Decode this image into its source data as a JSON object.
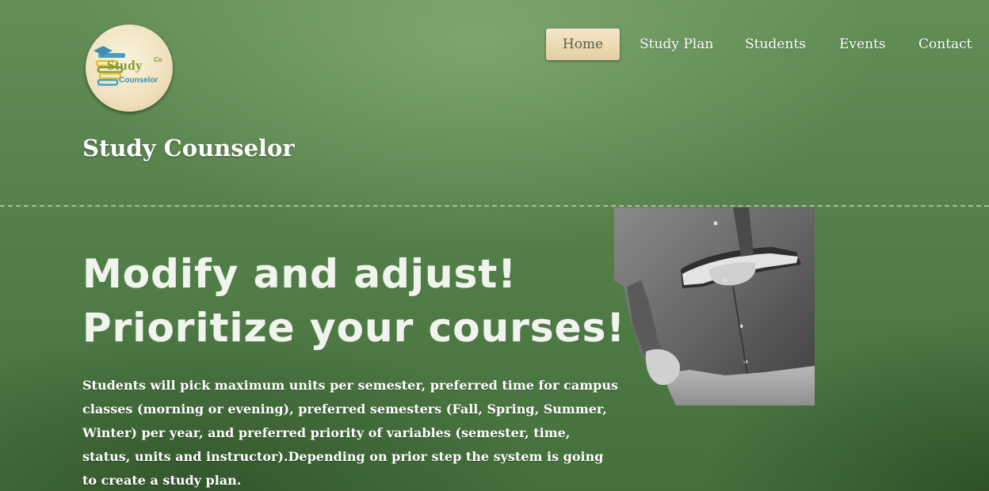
{
  "logo": {
    "study": "Study",
    "co": "Co",
    "counselor": "Counselor"
  },
  "site": {
    "name": "Study Counselor"
  },
  "nav": {
    "items": [
      {
        "label": "Home",
        "active": true
      },
      {
        "label": "Study Plan",
        "active": false
      },
      {
        "label": "Students",
        "active": false
      },
      {
        "label": "Events",
        "active": false
      },
      {
        "label": "Contact",
        "active": false
      }
    ]
  },
  "hero": {
    "headline_line1": "Modify and adjust!",
    "headline_line2": "Prioritize your courses!",
    "body": "Students will pick maximum units per semester, preferred time for campus classes (morning or evening), preferred semesters (Fall, Spring, Summer, Winter) per year, and preferred priority of variables (semester, time, status, units and instructor).Depending on prior step the system is going to create a study plan."
  },
  "colors": {
    "chalkboard_green": "#54804a",
    "nav_active_bg": "#e9d8af",
    "nav_active_text": "#5d5d4e",
    "text": "#ffffff"
  }
}
